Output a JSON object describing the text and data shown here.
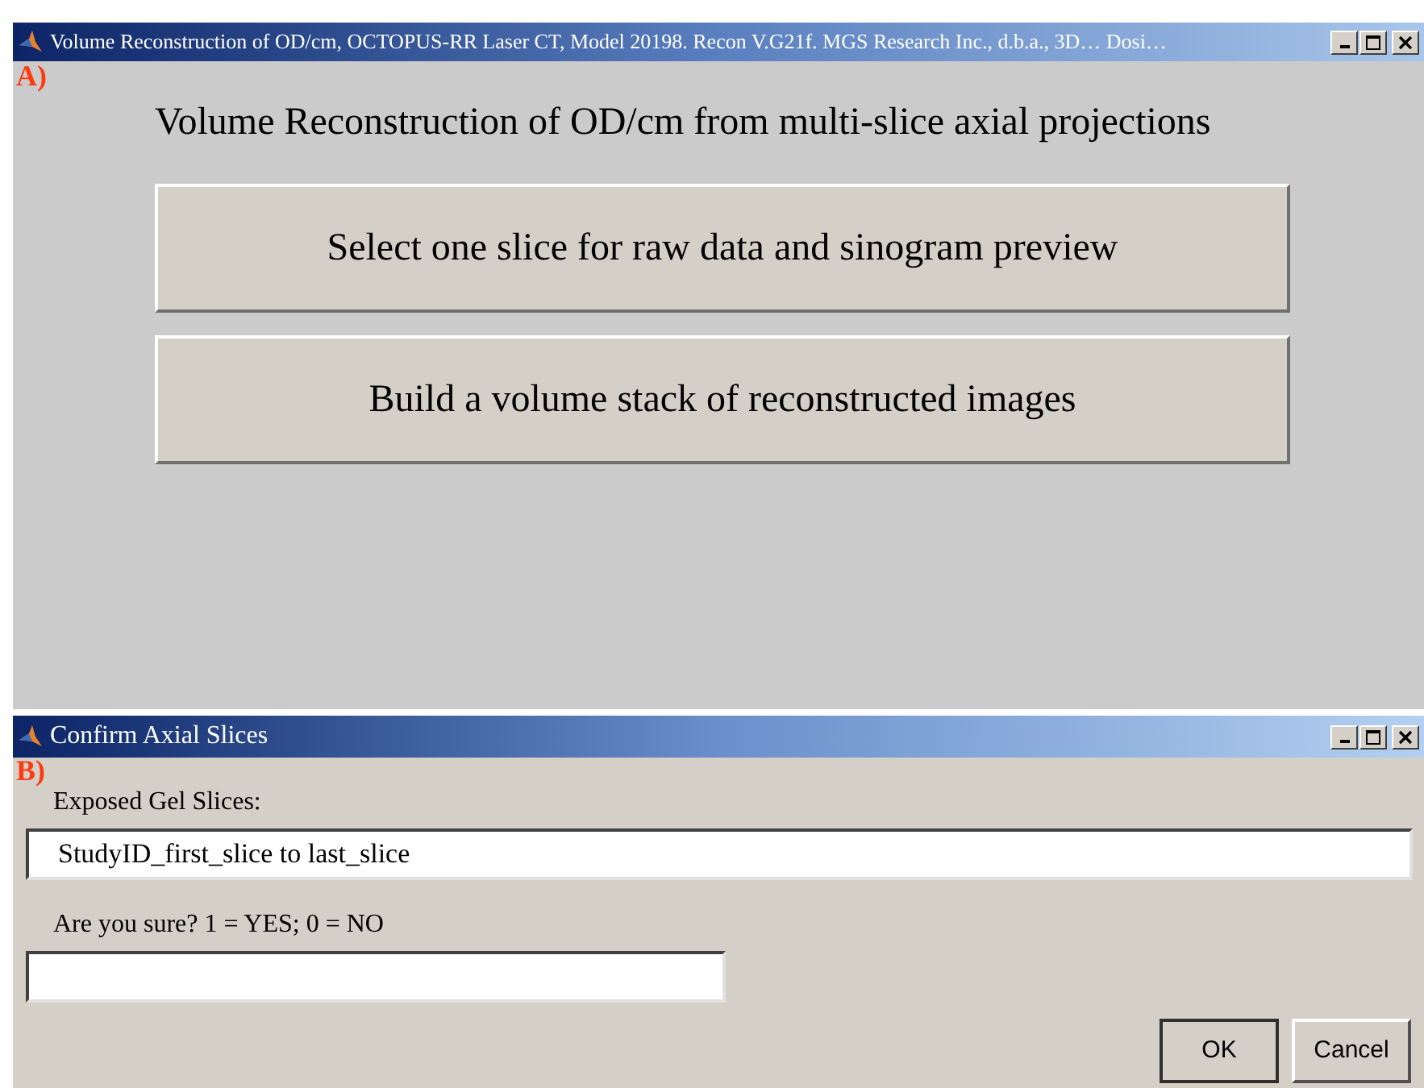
{
  "main_window": {
    "label": "A)",
    "title": "Volume Reconstruction of OD/cm, OCTOPUS-RR Laser CT, Model 20198. Recon V.G21f. MGS Research Inc., d.b.a., 3D… Dosi…",
    "heading": "Volume Reconstruction of OD/cm from multi-slice axial projections",
    "buttons": [
      "Select one slice for raw data and sinogram preview",
      "Build a volume stack of reconstructed images"
    ]
  },
  "dialog": {
    "label": "B)",
    "title": "Confirm Axial Slices",
    "fields": [
      {
        "label": "Exposed Gel Slices:",
        "value": "StudyID_first_slice to last_slice"
      },
      {
        "label": "Are you sure? 1 = YES; 0 = NO"
      }
    ],
    "buttons": [
      "OK",
      "Cancel"
    ]
  }
}
